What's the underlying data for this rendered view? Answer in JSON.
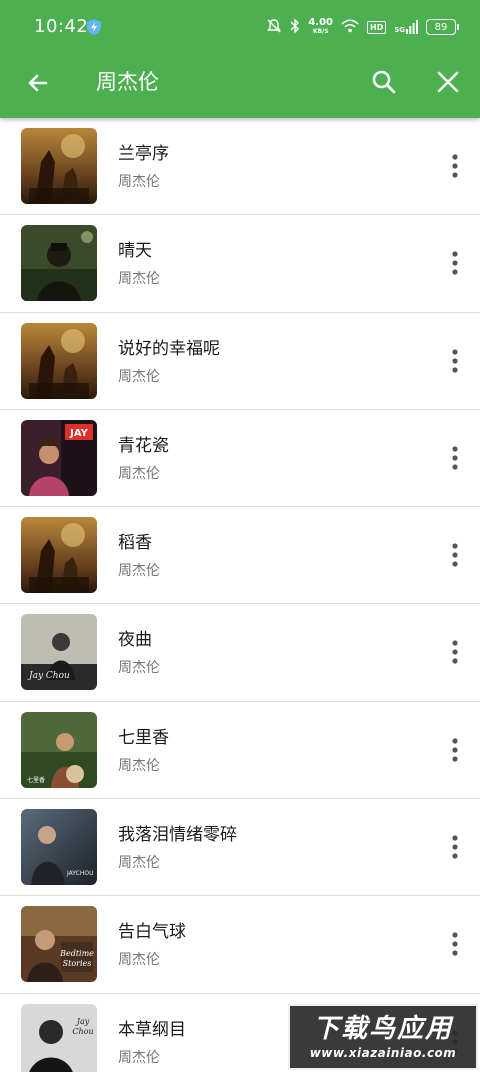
{
  "status_bar": {
    "time": "10:42",
    "net_speed_value": "4.00",
    "net_speed_unit": "KB/S",
    "hd_label": "HD",
    "signal_label": "5G",
    "battery_level": "89"
  },
  "toolbar": {
    "title": "周杰伦",
    "color": "#4caf50"
  },
  "songs": [
    {
      "title": "兰亭序",
      "artist": "周杰伦",
      "cover": "album-cover-1"
    },
    {
      "title": "晴天",
      "artist": "周杰伦",
      "cover": "album-cover-2"
    },
    {
      "title": "说好的幸福呢",
      "artist": "周杰伦",
      "cover": "album-cover-1"
    },
    {
      "title": "青花瓷",
      "artist": "周杰伦",
      "cover": "album-cover-3"
    },
    {
      "title": "稻香",
      "artist": "周杰伦",
      "cover": "album-cover-1"
    },
    {
      "title": "夜曲",
      "artist": "周杰伦",
      "cover": "album-cover-4"
    },
    {
      "title": "七里香",
      "artist": "周杰伦",
      "cover": "album-cover-5"
    },
    {
      "title": "我落泪情绪零碎",
      "artist": "周杰伦",
      "cover": "album-cover-6"
    },
    {
      "title": "告白气球",
      "artist": "周杰伦",
      "cover": "album-cover-7"
    },
    {
      "title": "本草纲目",
      "artist": "周杰伦",
      "cover": "album-cover-8"
    }
  ],
  "watermark": {
    "text": "下载鸟应用",
    "url": "www.xiazainiao.com"
  }
}
